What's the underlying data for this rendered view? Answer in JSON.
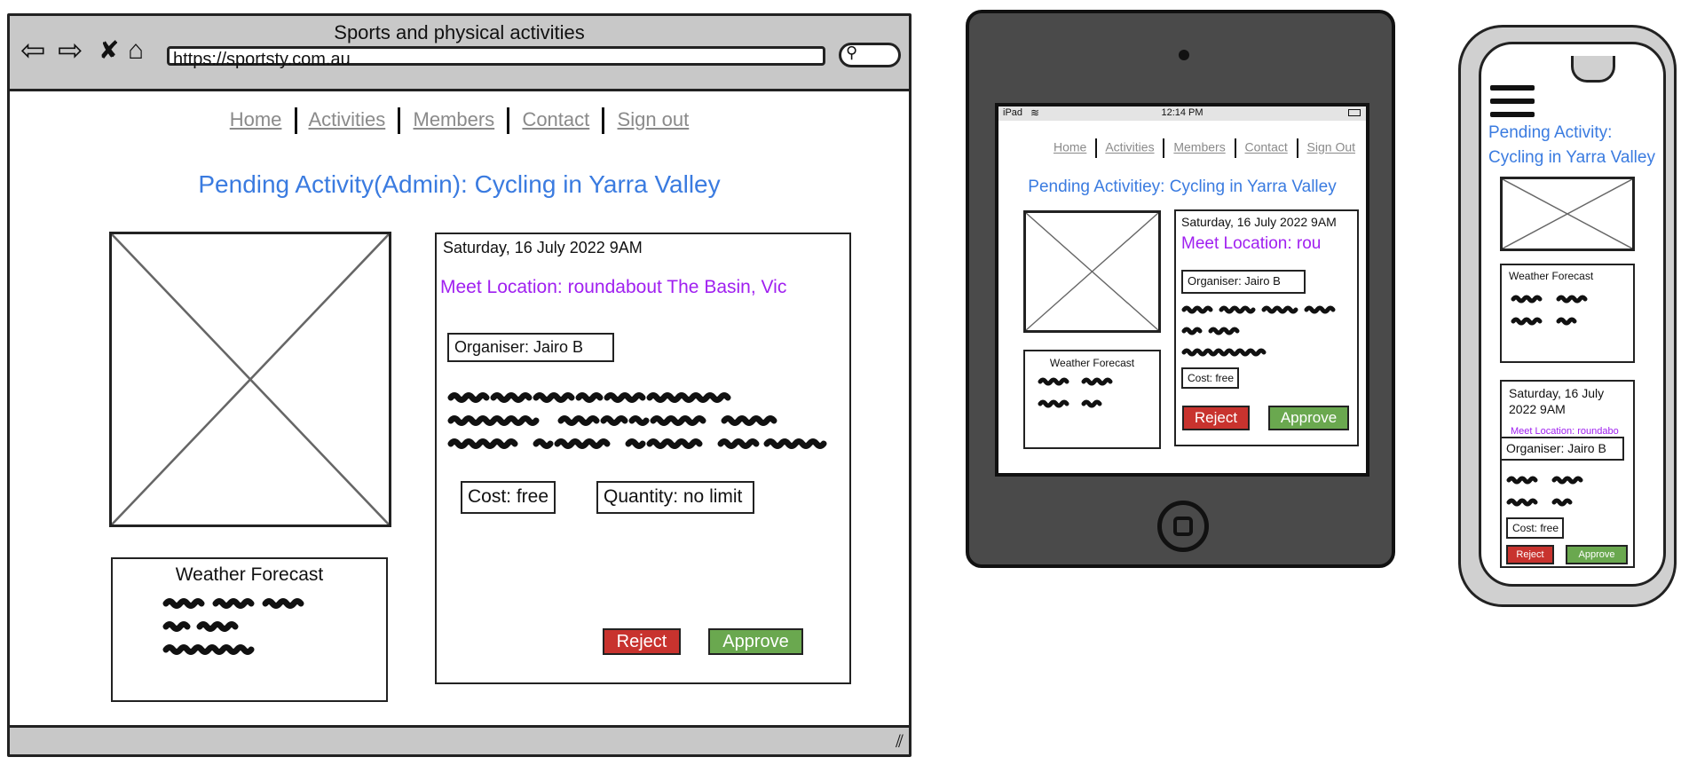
{
  "desktop": {
    "window_title": "Sports and physical activities",
    "url": "https://sportsty.com.au",
    "nav": [
      "Home",
      "Activities",
      "Members",
      "Contact",
      "Sign out"
    ],
    "heading": "Pending Activity(Admin): Cycling in Yarra Valley",
    "date": "Saturday, 16 July 2022 9AM",
    "meet_location": "Meet Location: roundabout The Basin, Vic",
    "organiser": "Organiser: Jairo B",
    "cost": "Cost: free",
    "quantity": "Quantity: no limit",
    "weather_title": "Weather Forecast",
    "reject": "Reject",
    "approve": "Approve"
  },
  "tablet": {
    "status_left": "iPad",
    "status_time": "12:14 PM",
    "nav": [
      "Home",
      "Activities",
      "Members",
      "Contact",
      "Sign Out"
    ],
    "heading": "Pending Activitiey: Cycling in Yarra Valley",
    "date": "Saturday, 16 July 2022 9AM",
    "meet_location": "Meet Location: rou",
    "organiser": "Organiser: Jairo B",
    "cost": "Cost: free",
    "weather_title": "Weather Forecast",
    "reject": "Reject",
    "approve": "Approve"
  },
  "phone": {
    "heading_line1": "Pending Activity:",
    "heading_line2": "Cycling in Yarra Valley",
    "weather_title": "Weather Forecast",
    "date_line1": "Saturday, 16 July",
    "date_line2": "2022 9AM",
    "meet_location": "Meet Location: roundabo",
    "organiser": "Organiser: Jairo B",
    "cost": "Cost: free",
    "reject": "Reject",
    "approve": "Approve"
  },
  "icons": [
    "back-arrow-icon",
    "forward-arrow-icon",
    "close-icon",
    "home-icon",
    "search-icon",
    "resize-grip-icon",
    "wifi-icon",
    "battery-icon",
    "camera-icon",
    "home-button-icon",
    "hamburger-menu-icon"
  ],
  "colors": {
    "heading": "#3a7be0",
    "meet_location": "#a020f0",
    "reject": "#c8332e",
    "approve": "#6aa84f",
    "chrome": "#c8c8c8"
  }
}
